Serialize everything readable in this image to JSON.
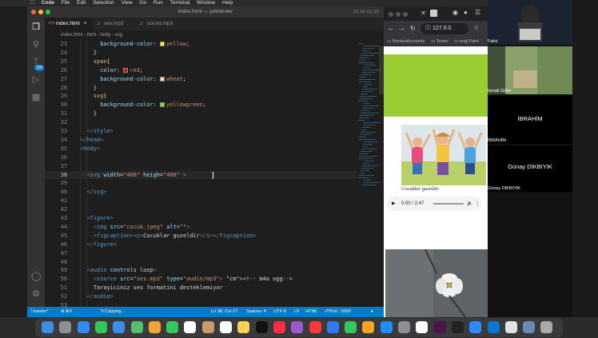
{
  "menubar": {
    "app": "Code",
    "items": [
      "File",
      "Edit",
      "Selection",
      "View",
      "Go",
      "Run",
      "Terminal",
      "Window",
      "Help"
    ]
  },
  "vscode": {
    "window_title": "index.html — yetiskinler",
    "tabs": [
      {
        "label": "index.html",
        "modified": "•"
      },
      {
        "label": "ses.mp3"
      },
      {
        "label": "sound.mp3"
      }
    ],
    "breadcrumb": [
      "index.html",
      "html",
      "body",
      "svg"
    ],
    "badge_count": "106",
    "colors": {
      "statusbar": "#007acc",
      "editor_bg": "#1e1e1e",
      "swatch_yellow": "#ffff00",
      "swatch_red": "#ff0000",
      "swatch_wheat": "#f5deb3",
      "swatch_yellowgreen": "#9acd32"
    },
    "lines": [
      {
        "n": "23",
        "text": "background-color: yellow;"
      },
      {
        "n": "24",
        "text": "}"
      },
      {
        "n": "25",
        "text": "span{"
      },
      {
        "n": "26",
        "text": "color: red;"
      },
      {
        "n": "27",
        "text": "background-color: wheat;"
      },
      {
        "n": "28",
        "text": "}"
      },
      {
        "n": "29",
        "text": "svg{"
      },
      {
        "n": "30",
        "text": "background-color: yellowgreen;"
      },
      {
        "n": "31",
        "text": "}"
      },
      {
        "n": "32",
        "text": ""
      },
      {
        "n": "33",
        "text": "</style>"
      },
      {
        "n": "34",
        "text": "</head>"
      },
      {
        "n": "35",
        "text": "<body>"
      },
      {
        "n": "36",
        "text": ""
      },
      {
        "n": "37",
        "text": ""
      },
      {
        "n": "38",
        "text": "<svg width=\"400\" heigh=\"400\" >"
      },
      {
        "n": "39",
        "text": ""
      },
      {
        "n": "40",
        "text": "</svg>"
      },
      {
        "n": "41",
        "text": ""
      },
      {
        "n": "42",
        "text": ""
      },
      {
        "n": "43",
        "text": "<figure>"
      },
      {
        "n": "44",
        "text": "<img src=\"cocuk.jpeg\" alt=\"\">"
      },
      {
        "n": "45",
        "text": "<figcaption><i>Cocuklar guzeldir</i></figcaption>"
      },
      {
        "n": "46",
        "text": "</figure>"
      },
      {
        "n": "47",
        "text": ""
      },
      {
        "n": "48",
        "text": ""
      },
      {
        "n": "49",
        "text": "<audio controls loop>"
      },
      {
        "n": "50",
        "text": "<source src=\"ses.mp3\" type=\"audio/mp3\"> <!-- m4a ogg-->"
      },
      {
        "n": "51",
        "text": "Tarayiciniz ses formatini desteklemiyor"
      },
      {
        "n": "52",
        "text": "</audio>"
      },
      {
        "n": "53",
        "text": ""
      }
    ],
    "status": {
      "branch": "master*",
      "errors": "0",
      "warnings": "0",
      "copying": "Copying...",
      "position": "Ln 38, Col 27",
      "spaces": "Spaces: 4",
      "encoding": "UTF-8",
      "eol": "LF",
      "language": "HTML",
      "port": "Port : 5500"
    }
  },
  "browser": {
    "url": "127.0.0.",
    "bookmarks": [
      "NordeaAccounts",
      "Tester",
      "engl Fahri"
    ],
    "page": {
      "svg_color": "#9acd32",
      "figcaption": "Cocuklar guzeldir",
      "audio_time": "0:00 / 2:47",
      "audio_progress": 0
    }
  },
  "videos": [
    {
      "name": "Fahri"
    },
    {
      "name": "Ismail Güler"
    },
    {
      "center": "İBRAHİM",
      "name": "İBRAHİM"
    },
    {
      "center": "Günay DİKBIYIK",
      "name": "Günay DİKBIYIK"
    },
    {
      "name": ""
    },
    {
      "name": ""
    }
  ],
  "dock": {
    "apps": [
      "finder",
      "launchpad",
      "safari",
      "messages",
      "mail",
      "maps",
      "photos",
      "facetime",
      "calendar",
      "contacts",
      "reminders",
      "notes",
      "tv",
      "music",
      "podcasts",
      "news",
      "keynote",
      "numbers",
      "pages",
      "app-store",
      "system-preferences",
      "chrome",
      "slack",
      "terminal",
      "zoom",
      "vscode",
      "preview",
      "finder-window",
      "trash"
    ]
  }
}
